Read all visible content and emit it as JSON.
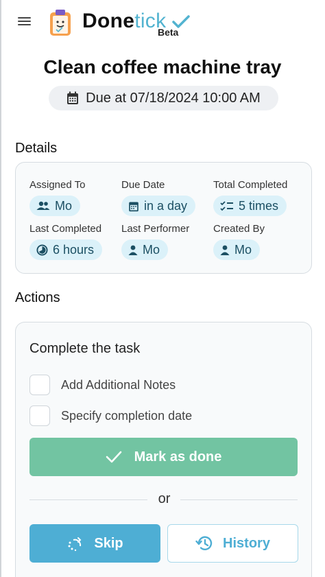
{
  "header": {
    "brand_main": "Done",
    "brand_accent": "tick",
    "badge": "Beta",
    "menu_icon": "hamburger-menu-icon",
    "logo_icon": "clipboard-logo-icon"
  },
  "task": {
    "title": "Clean coffee machine tray",
    "due_text": "Due at 07/18/2024 10:00 AM",
    "due_icon": "calendar-icon"
  },
  "details": {
    "heading": "Details",
    "items": [
      {
        "label": "Assigned To",
        "value": "Mo",
        "icon": "people-icon"
      },
      {
        "label": "Due Date",
        "value": "in a day",
        "icon": "calendar-icon"
      },
      {
        "label": "Total Completed",
        "value": "5 times",
        "icon": "checklist-icon"
      },
      {
        "label": "Last Completed",
        "value": "6 hours",
        "icon": "clock-icon"
      },
      {
        "label": "Last Performer",
        "value": "Mo",
        "icon": "person-icon"
      },
      {
        "label": "Created By",
        "value": "Mo",
        "icon": "person-icon"
      }
    ]
  },
  "actions": {
    "heading": "Actions",
    "complete_title": "Complete the task",
    "options": [
      {
        "label": "Add Additional Notes",
        "checked": false
      },
      {
        "label": "Specify completion date",
        "checked": false
      }
    ],
    "mark_done": "Mark as done",
    "or": "or",
    "skip": "Skip",
    "history": "History"
  },
  "colors": {
    "accent": "#52b3d0",
    "success": "#72c4a2",
    "skip": "#4eaed4",
    "chip_bg": "#dbf1f9",
    "chip_text": "#1b4f63"
  }
}
